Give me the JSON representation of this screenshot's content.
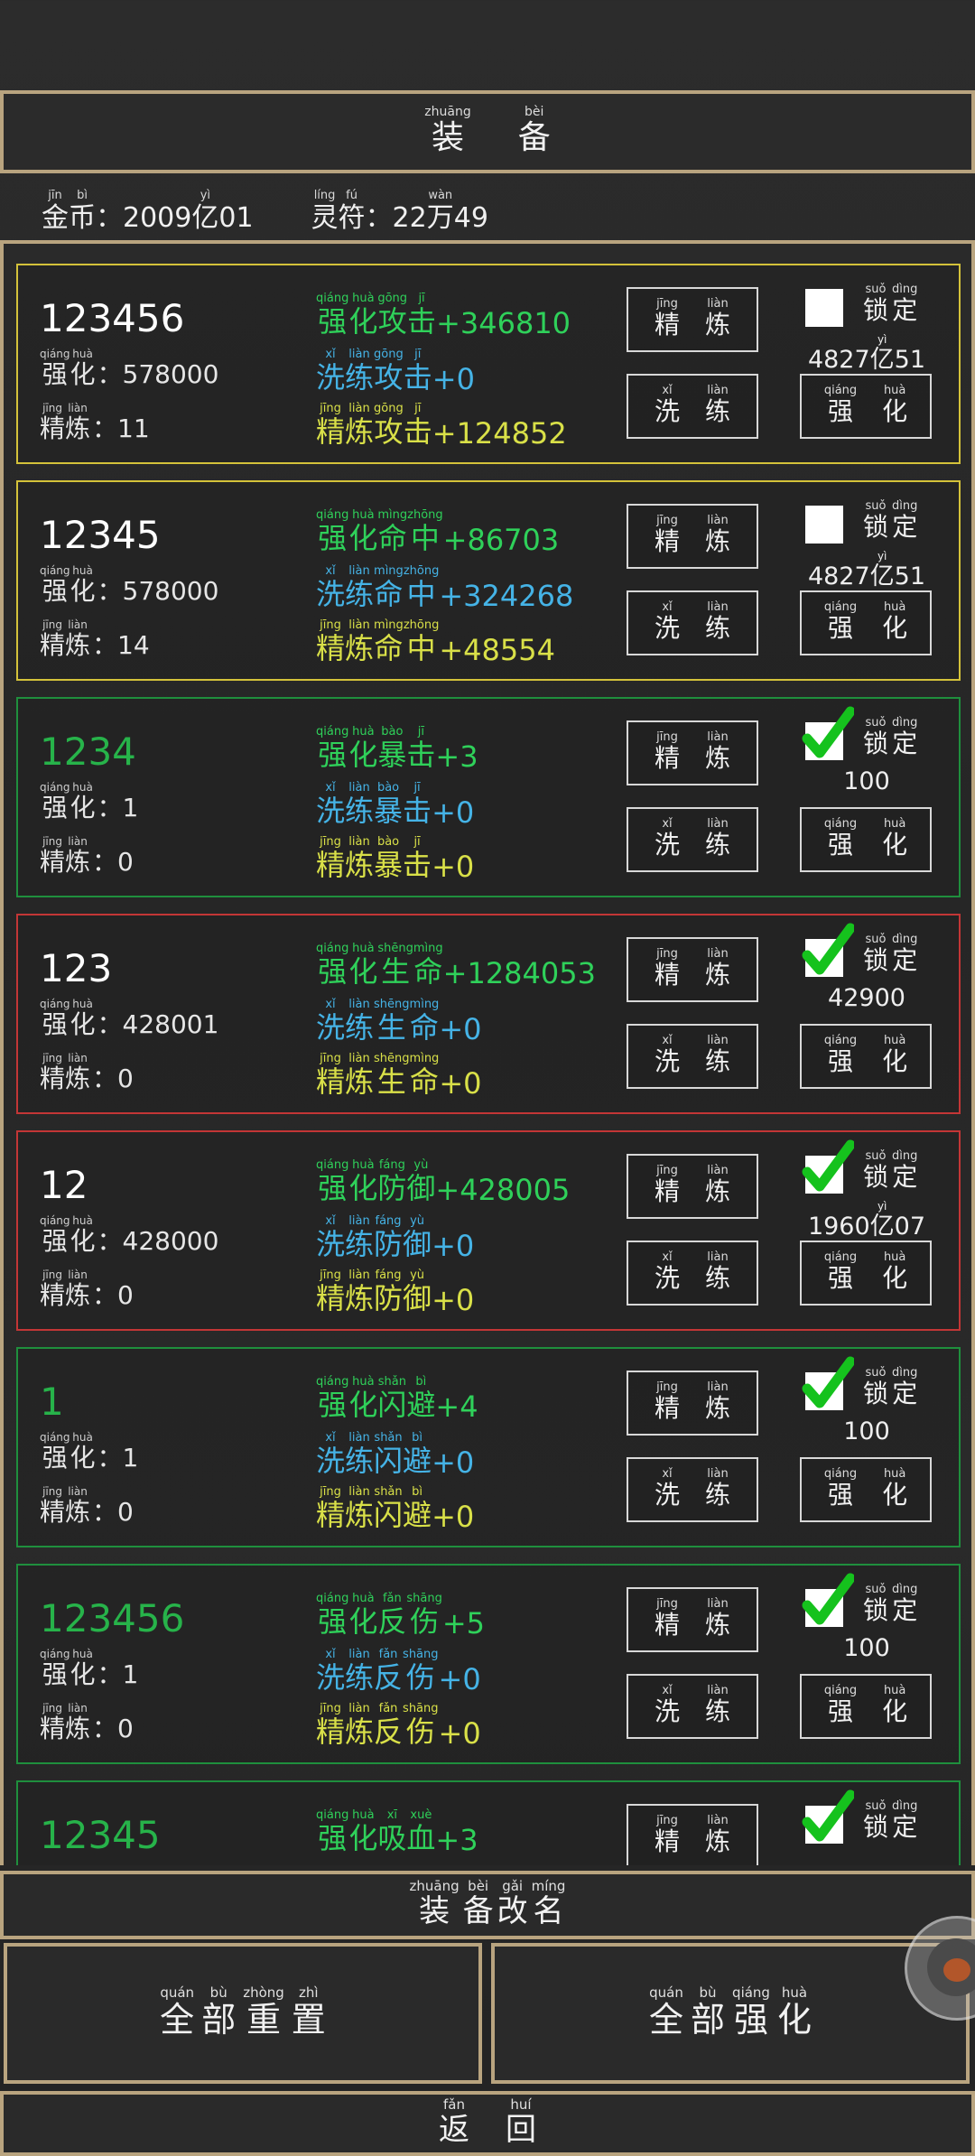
{
  "header": {
    "title": [
      {
        "c": "装",
        "p": "zhuāng"
      },
      {
        "c": "备",
        "p": "bèi"
      }
    ]
  },
  "currency": {
    "gold_label": [
      {
        "c": "金",
        "p": "jīn"
      },
      {
        "c": "币",
        "p": "bì"
      }
    ],
    "gold_value_a": "：2009",
    "gold_yi": {
      "c": "亿",
      "p": "yì"
    },
    "gold_value_b": "01",
    "talisman_label": [
      {
        "c": "灵",
        "p": "líng"
      },
      {
        "c": "符",
        "p": "fú"
      }
    ],
    "talisman_value_a": "：22",
    "talisman_wan": {
      "c": "万",
      "p": "wàn"
    },
    "talisman_value_b": "49"
  },
  "labels": {
    "enhance": [
      {
        "c": "强",
        "p": "qiáng"
      },
      {
        "c": "化",
        "p": "huà"
      }
    ],
    "refine": [
      {
        "c": "精",
        "p": "jīng"
      },
      {
        "c": "炼",
        "p": "liàn"
      }
    ],
    "wash": [
      {
        "c": "洗",
        "p": "xǐ"
      },
      {
        "c": "练",
        "p": "liàn"
      }
    ],
    "lock": [
      {
        "c": "锁",
        "p": "suǒ"
      },
      {
        "c": "定",
        "p": "dìng"
      }
    ],
    "yi": {
      "c": "亿",
      "p": "yì"
    }
  },
  "items": [
    {
      "name": "123456",
      "name_color": "white",
      "border": "yellow",
      "enhance": "：578000",
      "refine": "：11",
      "attr": [
        {
          "c": "攻",
          "p": "gōng"
        },
        {
          "c": "击",
          "p": "jī"
        }
      ],
      "s1": "+346810",
      "s2": "+0",
      "s3": "+124852",
      "locked": false,
      "cost_a": "4827",
      "cost_b": "51",
      "cost_yi": true
    },
    {
      "name": "12345",
      "name_color": "white",
      "border": "yellow",
      "enhance": "：578000",
      "refine": "：14",
      "attr": [
        {
          "c": "命",
          "p": "mìng"
        },
        {
          "c": "中",
          "p": "zhōng"
        }
      ],
      "s1": "+86703",
      "s2": "+324268",
      "s3": "+48554",
      "locked": false,
      "cost_a": "4827",
      "cost_b": "51",
      "cost_yi": true
    },
    {
      "name": "1234",
      "name_color": "green",
      "border": "green",
      "enhance": "：1",
      "refine": "：0",
      "attr": [
        {
          "c": "暴",
          "p": "bào"
        },
        {
          "c": "击",
          "p": "jī"
        }
      ],
      "s1": "+3",
      "s2": "+0",
      "s3": "+0",
      "locked": true,
      "cost_a": "100",
      "cost_b": "",
      "cost_yi": false
    },
    {
      "name": "123",
      "name_color": "white",
      "border": "red",
      "enhance": "：428001",
      "refine": "：0",
      "attr": [
        {
          "c": "生",
          "p": "shēng"
        },
        {
          "c": "命",
          "p": "mìng"
        }
      ],
      "s1": "+1284053",
      "s2": "+0",
      "s3": "+0",
      "locked": true,
      "cost_a": "42900",
      "cost_b": "",
      "cost_yi": false
    },
    {
      "name": "12",
      "name_color": "white",
      "border": "red",
      "enhance": "：428000",
      "refine": "：0",
      "attr": [
        {
          "c": "防",
          "p": "fáng"
        },
        {
          "c": "御",
          "p": "yù"
        }
      ],
      "s1": "+428005",
      "s2": "+0",
      "s3": "+0",
      "locked": true,
      "cost_a": "1960",
      "cost_b": "07",
      "cost_yi": true
    },
    {
      "name": "1",
      "name_color": "green",
      "border": "green",
      "enhance": "：1",
      "refine": "：0",
      "attr": [
        {
          "c": "闪",
          "p": "shǎn"
        },
        {
          "c": "避",
          "p": "bì"
        }
      ],
      "s1": "+4",
      "s2": "+0",
      "s3": "+0",
      "locked": true,
      "cost_a": "100",
      "cost_b": "",
      "cost_yi": false
    },
    {
      "name": "123456",
      "name_color": "green",
      "border": "green",
      "enhance": "：1",
      "refine": "：0",
      "attr": [
        {
          "c": "反",
          "p": "fǎn"
        },
        {
          "c": "伤",
          "p": "shāng"
        }
      ],
      "s1": "+5",
      "s2": "+0",
      "s3": "+0",
      "locked": true,
      "cost_a": "100",
      "cost_b": "",
      "cost_yi": false
    },
    {
      "name": "12345",
      "name_color": "green",
      "border": "green",
      "enhance": "",
      "refine": "",
      "attr": [
        {
          "c": "吸",
          "p": "xī"
        },
        {
          "c": "血",
          "p": "xuè"
        }
      ],
      "s1": "+3",
      "s2": "",
      "s3": "",
      "locked": true,
      "cost_a": "",
      "cost_b": "",
      "cost_yi": false
    }
  ],
  "footer": {
    "rename": [
      {
        "c": "装",
        "p": "zhuāng"
      },
      {
        "c": "备",
        "p": "bèi"
      },
      {
        "c": "改",
        "p": "gǎi"
      },
      {
        "c": "名",
        "p": "míng"
      }
    ],
    "reset_all": [
      {
        "c": "全",
        "p": "quán"
      },
      {
        "c": "部",
        "p": "bù"
      },
      {
        "c": "重",
        "p": "zhòng"
      },
      {
        "c": "置",
        "p": "zhì"
      }
    ],
    "enhance_all": [
      {
        "c": "全",
        "p": "quán"
      },
      {
        "c": "部",
        "p": "bù"
      },
      {
        "c": "强",
        "p": "qiáng"
      },
      {
        "c": "化",
        "p": "huà"
      }
    ],
    "back": [
      {
        "c": "返",
        "p": "fǎn"
      },
      {
        "c": "回",
        "p": "huí"
      }
    ]
  }
}
